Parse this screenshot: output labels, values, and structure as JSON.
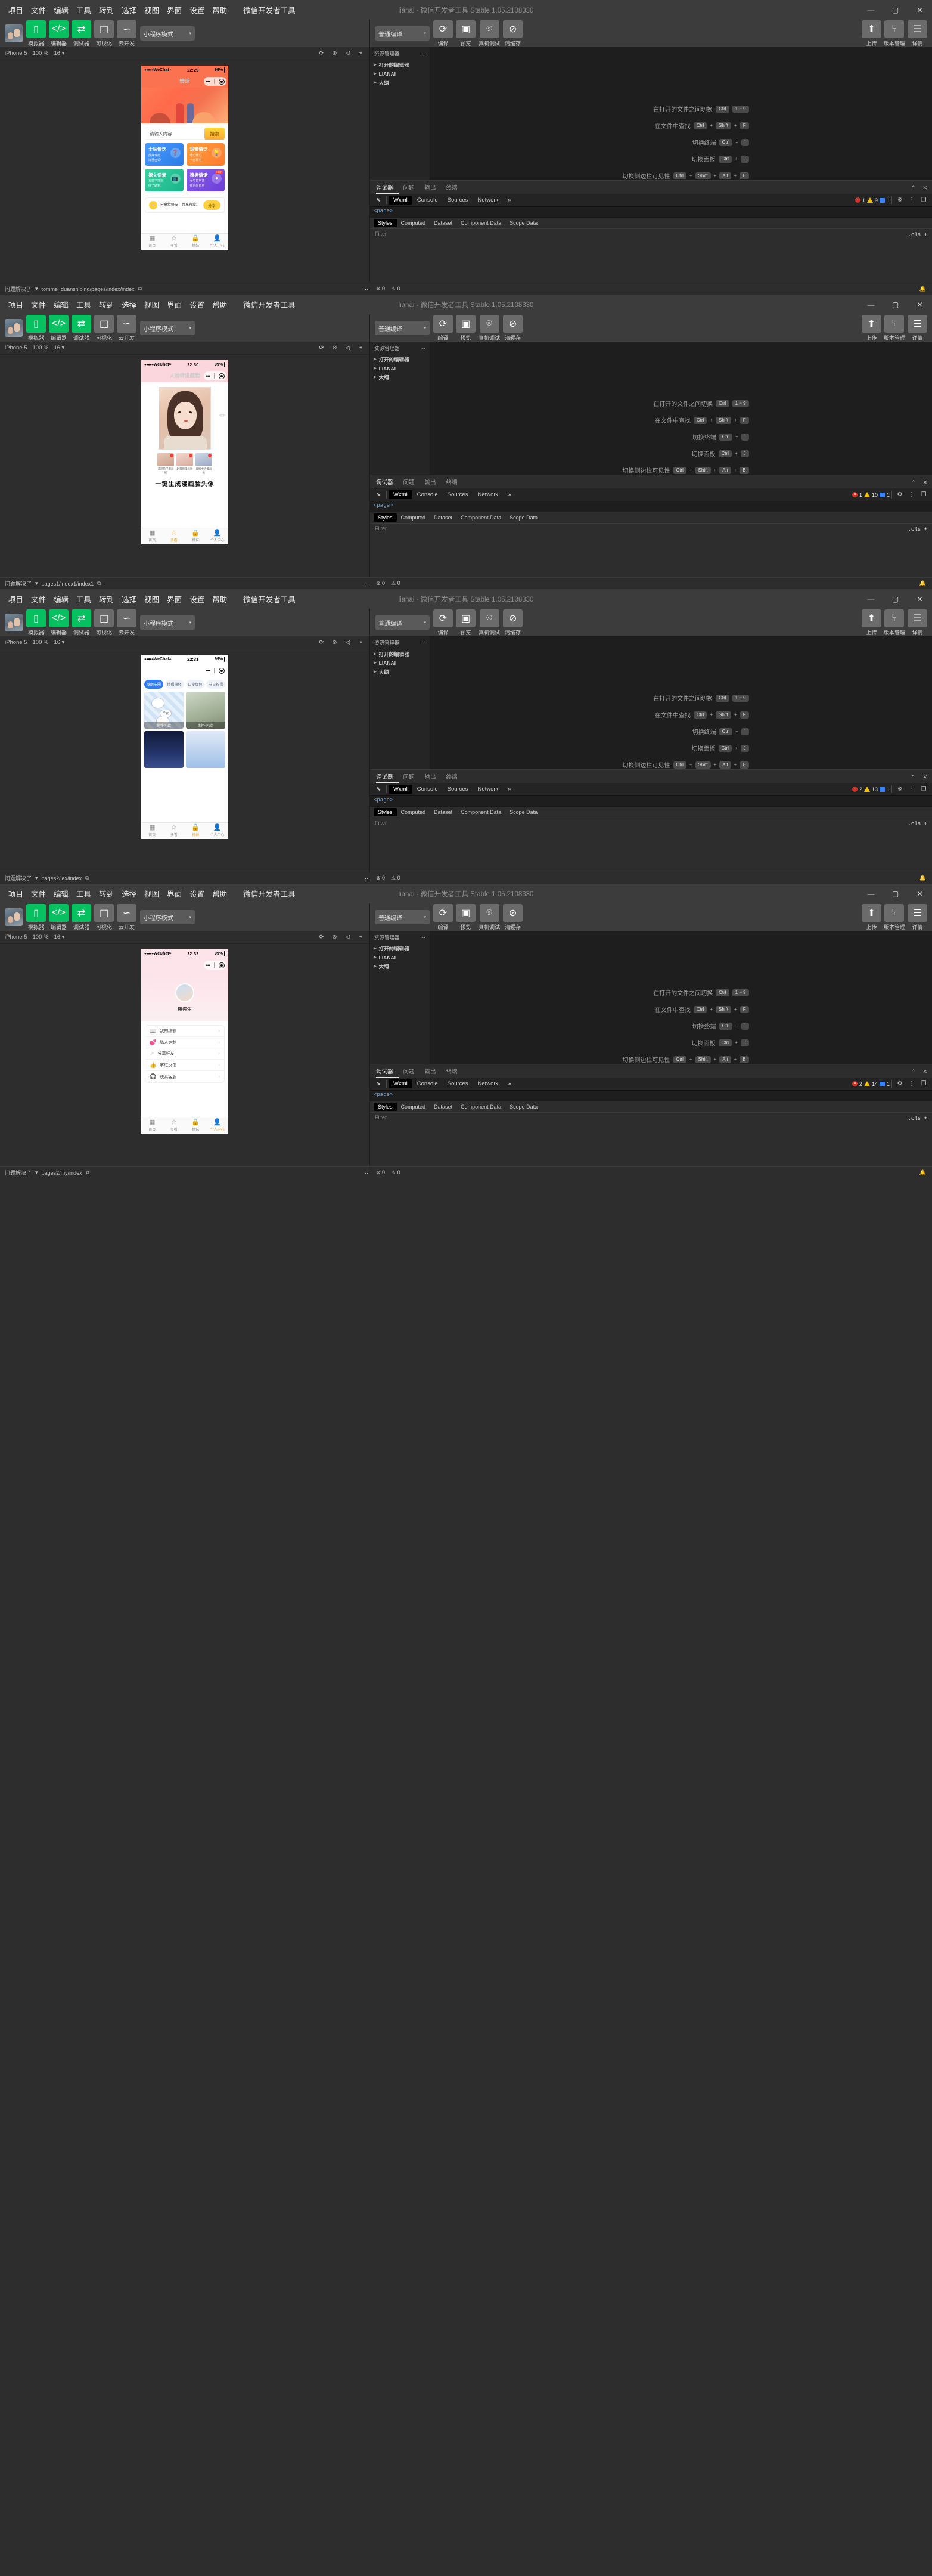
{
  "app": {
    "menu": [
      "项目",
      "文件",
      "编辑",
      "工具",
      "转到",
      "选择",
      "视图",
      "界面",
      "设置",
      "帮助",
      "微信开发者工具"
    ],
    "window_title": "lianai - 微信开发者工具 Stable 1.05.2108330",
    "win_minimize": "—",
    "win_maximize": "▢",
    "win_close": "✕"
  },
  "toolbar": {
    "buttons": [
      {
        "icon": "simulator-icon",
        "glyph": "▯",
        "label": "模拟器",
        "style": "green"
      },
      {
        "icon": "editor-icon",
        "glyph": "</>",
        "label": "编辑器",
        "style": "green"
      },
      {
        "icon": "debugger-icon",
        "glyph": "⇄",
        "label": "调试器",
        "style": "green"
      },
      {
        "icon": "visual-icon",
        "glyph": "◫",
        "label": "可视化",
        "style": "grey"
      },
      {
        "icon": "cloud-icon",
        "glyph": "∽",
        "label": "云开发",
        "style": "grey"
      }
    ],
    "mode_select": "小程序模式",
    "compile_select": "普通编译",
    "right_buttons": [
      {
        "icon": "upload-icon",
        "glyph": "⬆",
        "label": "上传"
      },
      {
        "icon": "version-icon",
        "glyph": "⑂",
        "label": "版本管理"
      },
      {
        "icon": "details-icon",
        "glyph": "☰",
        "label": "详情"
      }
    ],
    "right_tools": [
      {
        "icon": "compile-icon",
        "glyph": "⟳",
        "label": "编译"
      },
      {
        "icon": "preview-icon",
        "glyph": "▣",
        "label": "预览"
      },
      {
        "icon": "realdebug-icon",
        "glyph": "⌾",
        "label": "真机调试"
      },
      {
        "icon": "clearcache-icon",
        "glyph": "⊘",
        "label": "清缓存"
      }
    ],
    "device_row": {
      "device": "iPhone 5",
      "zoom": "100 %",
      "scale": "16 ▾",
      "icons": [
        "rotate-icon",
        "record-icon",
        "mute-icon",
        "location-icon"
      ]
    }
  },
  "explorer": {
    "title": "资源管理器",
    "more": "···",
    "items": [
      "打开的编辑器",
      "LIANAI",
      "大纲"
    ]
  },
  "shortcuts": {
    "rows": [
      {
        "label": "在打开的文件之间切换",
        "keys": [
          "Ctrl",
          "1 ~ 9"
        ],
        "seps": [
          ""
        ]
      },
      {
        "label": "在文件中查找",
        "keys": [
          "Ctrl",
          "Shift",
          "F"
        ],
        "seps": [
          "+",
          "+"
        ]
      },
      {
        "label": "切换终端",
        "keys": [
          "Ctrl",
          "`"
        ],
        "seps": [
          "+"
        ]
      },
      {
        "label": "切换面板",
        "keys": [
          "Ctrl",
          "J"
        ],
        "seps": [
          "+"
        ]
      },
      {
        "label": "切换侧边栏可见性",
        "keys": [
          "Ctrl",
          "Shift",
          "Alt",
          "B"
        ],
        "seps": [
          "+",
          "+",
          "+"
        ]
      }
    ]
  },
  "devtools": {
    "tabs": [
      "调试器",
      "问题",
      "输出",
      "终端"
    ],
    "active_tab": "调试器",
    "collapse_icon": "⌃",
    "close_icon": "✕",
    "panel_tabs": [
      "Wxml",
      "Console",
      "Sources",
      "Network"
    ],
    "active_panel": "Wxml",
    "more_panels": "»",
    "inspect_icon": "⬉",
    "settings_icon": "⚙",
    "kebab_icon": "⋮",
    "dock_icon": "❐",
    "code_line": "<page>",
    "sub_tabs": [
      "Styles",
      "Computed",
      "Dataset",
      "Component Data",
      "Scope Data"
    ],
    "active_sub": "Styles",
    "filter_placeholder": "Filter",
    "cls_label": ".cls",
    "plus_label": "+"
  },
  "status": {
    "left_label": "问题解决了",
    "caret": "▾",
    "errors": "0",
    "warnings": "0",
    "err_icon": "⊗",
    "warn_icon": "⚠",
    "bell_icon": "🔔"
  },
  "windows": [
    {
      "path": "tomme_duanshiping/pages/index/index",
      "status_path": "tomme_duanshiping/pages/index/index",
      "counts": {
        "errors": "1",
        "warnings": "9",
        "info": "1"
      },
      "phone": {
        "carrier": "WeChat",
        "dots": "●●●●●",
        "wifi": "≈",
        "time": "22:29",
        "battery": "99%",
        "nav_title": "情话",
        "capsule_dots": "•••"
      },
      "page": {
        "type": "home",
        "search_placeholder": "请输入内容",
        "search_button": "搜索",
        "cards": [
          {
            "title": "土味情话",
            "sub": "撩妹专用\n海量台词!",
            "icon": "❓",
            "hot": ""
          },
          {
            "title": "甜蜜情话",
            "sub": "暖心暖心\n一击即中",
            "icon": "💡",
            "hot": ""
          },
          {
            "title": "撩女语录",
            "sub": "万能不撩到\n撩了聊到",
            "icon": "📺",
            "hot": ""
          },
          {
            "title": "撩男情话",
            "sub": "女生撩男孩\n撩他很管用",
            "icon": "✈",
            "hot": "HOT"
          }
        ],
        "share": {
          "title": "分享给好友，共享有爱。",
          "button": "分享",
          "icon": "♥"
        }
      },
      "tabbar": [
        {
          "icon": "grid-icon",
          "glyph": "▦",
          "label": "首页",
          "active": false
        },
        {
          "icon": "star-icon",
          "glyph": "☆",
          "label": "多看",
          "active": false
        },
        {
          "icon": "lock-icon",
          "glyph": "🔒",
          "label": "撩妹",
          "active": false
        },
        {
          "icon": "user-icon",
          "glyph": "👤",
          "label": "个人中心",
          "active": false
        }
      ]
    },
    {
      "path": "pages1/index1/index1",
      "status_path": "pages1/index1/index1",
      "counts": {
        "errors": "1",
        "warnings": "10",
        "info": "1"
      },
      "phone": {
        "carrier": "WeChat",
        "dots": "●●●●●",
        "wifi": "≈",
        "time": "22:30",
        "battery": "99%",
        "nav_title": "人脸转漫画脸",
        "capsule_dots": "•••"
      },
      "page": {
        "type": "avatar",
        "headline": "一键生成漫画脸头像",
        "thumbs": [
          {
            "label": "迪丽热巴漫画脸"
          },
          {
            "label": "赵露思漫画脸"
          },
          {
            "label": "鹿晗卡通漫画脸"
          }
        ]
      },
      "tabbar": [
        {
          "icon": "grid-icon",
          "glyph": "▦",
          "label": "首页",
          "active": false
        },
        {
          "icon": "star-icon",
          "glyph": "☆",
          "label": "多看",
          "active": true
        },
        {
          "icon": "lock-icon",
          "glyph": "🔒",
          "label": "撩妹",
          "active": false
        },
        {
          "icon": "user-icon",
          "glyph": "👤",
          "label": "个人中心",
          "active": false
        }
      ]
    },
    {
      "path": "pages2/lex/index",
      "status_path": "pages2/lex/index",
      "counts": {
        "errors": "2",
        "warnings": "13",
        "info": "1"
      },
      "phone": {
        "carrier": "WeChat",
        "dots": "●●●●●",
        "wifi": "≈",
        "time": "22:31",
        "battery": "99%",
        "nav_title": "",
        "capsule_dots": "•••"
      },
      "page": {
        "type": "grid",
        "chips": [
          {
            "label": "发朋友圈",
            "active": true
          },
          {
            "label": "情侣搞怪",
            "active": false
          },
          {
            "label": "口令红包",
            "active": false
          },
          {
            "label": "节日祝福",
            "active": false
          }
        ],
        "tiles": [
          {
            "caption": "制作同款",
            "style": "blue"
          },
          {
            "caption": "制作同款",
            "style": "cat"
          },
          {
            "caption": "",
            "style": "night"
          },
          {
            "caption": "",
            "style": "sky"
          }
        ]
      },
      "tabbar": [
        {
          "icon": "grid-icon",
          "glyph": "▦",
          "label": "首页",
          "active": false
        },
        {
          "icon": "star-icon",
          "glyph": "☆",
          "label": "多看",
          "active": false
        },
        {
          "icon": "lock-icon",
          "glyph": "🔒",
          "label": "撩妹",
          "active": true
        },
        {
          "icon": "user-icon",
          "glyph": "👤",
          "label": "个人中心",
          "active": false
        }
      ]
    },
    {
      "path": "pages2/my/index",
      "status_path": "pages2/my/index",
      "counts": {
        "errors": "2",
        "warnings": "14",
        "info": "1"
      },
      "phone": {
        "carrier": "WeChat",
        "dots": "●●●●●",
        "wifi": "≈",
        "time": "22:32",
        "battery": "99%",
        "nav_title": "",
        "capsule_dots": "•••"
      },
      "page": {
        "type": "profile",
        "user_name": "慈先生",
        "menu": [
          {
            "icon": "book-icon",
            "glyph": "📖",
            "label": "我的编辑",
            "chev": "›"
          },
          {
            "icon": "heart-icon",
            "glyph": "💕",
            "label": "私人定制",
            "chev": "›"
          },
          {
            "icon": "share-icon",
            "glyph": "↗",
            "label": "分享好友",
            "chev": "›"
          },
          {
            "icon": "praise-icon",
            "glyph": "👍",
            "label": "拿过反馈",
            "chev": "›"
          },
          {
            "icon": "service-icon",
            "glyph": "🎧",
            "label": "联系客服",
            "chev": "›"
          }
        ]
      },
      "tabbar": [
        {
          "icon": "grid-icon",
          "glyph": "▦",
          "label": "首页",
          "active": false
        },
        {
          "icon": "star-icon",
          "glyph": "☆",
          "label": "多看",
          "active": false
        },
        {
          "icon": "lock-icon",
          "glyph": "🔒",
          "label": "撩妹",
          "active": false
        },
        {
          "icon": "user-icon",
          "glyph": "👤",
          "label": "个人中心",
          "active": true
        }
      ]
    }
  ],
  "colors": {
    "accent_green": "#07c160",
    "bg_dark": "#2d2d2d",
    "bg_darker": "#1e1e1e",
    "titlebar": "#3c3c3c",
    "error_red": "#d93025",
    "warn_yellow": "#f2c000"
  }
}
